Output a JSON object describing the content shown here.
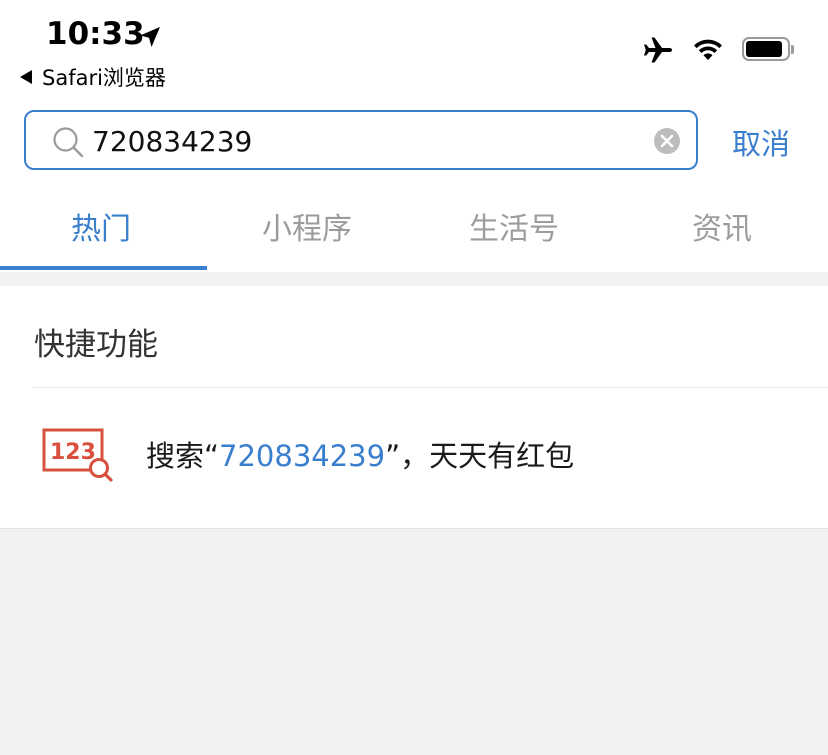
{
  "status_bar": {
    "time": "10:33",
    "back_app": "Safari浏览器",
    "icons": [
      "location-arrow-icon",
      "airplane-icon",
      "wifi-icon",
      "battery-icon"
    ]
  },
  "search": {
    "query": "720834239",
    "cancel_label": "取消"
  },
  "tabs": [
    {
      "label": "热门",
      "active": true
    },
    {
      "label": "小程序",
      "active": false
    },
    {
      "label": "生活号",
      "active": false
    },
    {
      "label": "资讯",
      "active": false
    }
  ],
  "quick_functions": {
    "title": "快捷功能",
    "item": {
      "prefix": "搜索“",
      "keyword": "720834239",
      "suffix": "”，天天有红包",
      "icon": "number-search-icon"
    }
  },
  "colors": {
    "accent": "#3a7fce",
    "icon_red": "#d9503f",
    "background": "#f2f2f4"
  }
}
